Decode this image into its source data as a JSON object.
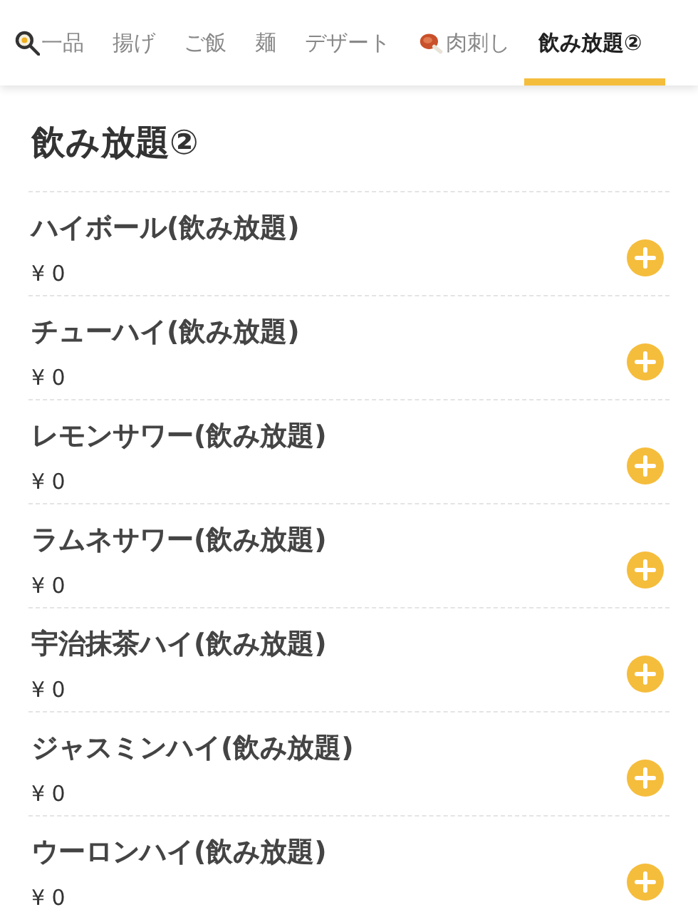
{
  "tabs": [
    {
      "label": "一品",
      "kind": "pan",
      "selected": false
    },
    {
      "label": "揚げ",
      "kind": "plain",
      "selected": false
    },
    {
      "label": "ご飯",
      "kind": "plain",
      "selected": false
    },
    {
      "label": "麺",
      "kind": "plain",
      "selected": false
    },
    {
      "label": "デザート",
      "kind": "plain",
      "selected": false
    },
    {
      "label": "肉刺し",
      "kind": "meat",
      "selected": false
    },
    {
      "label": "飲み放題②",
      "kind": "plain",
      "selected": true
    }
  ],
  "section": {
    "title": "飲み放題②"
  },
  "items": [
    {
      "name": "ハイボール(飲み放題)",
      "price": "¥ 0"
    },
    {
      "name": "チューハイ(飲み放題)",
      "price": "¥ 0"
    },
    {
      "name": "レモンサワー(飲み放題)",
      "price": "¥ 0"
    },
    {
      "name": "ラムネサワー(飲み放題)",
      "price": "¥ 0"
    },
    {
      "name": "宇治抹茶ハイ(飲み放題)",
      "price": "¥ 0"
    },
    {
      "name": "ジャスミンハイ(飲み放題)",
      "price": "¥ 0"
    },
    {
      "name": "ウーロンハイ(飲み放題)",
      "price": "¥ 0"
    }
  ]
}
